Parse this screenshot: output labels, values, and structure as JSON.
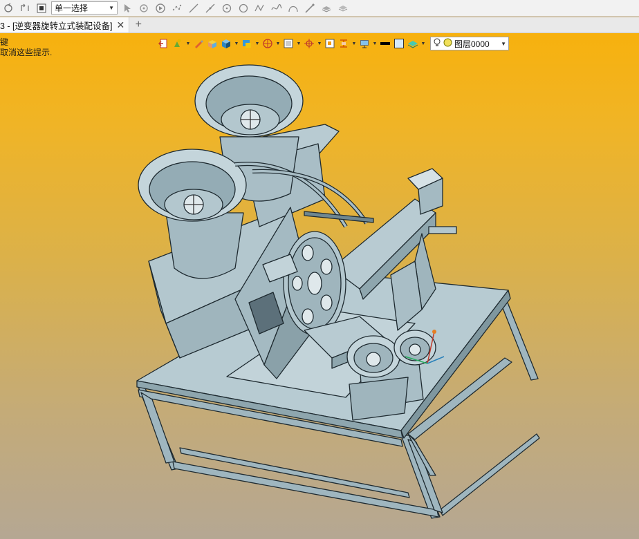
{
  "toolbar": {
    "selection_mode": "单一选择",
    "icons": [
      "rotate-icon",
      "pan-icon",
      "stop-icon",
      "select-arrow-icon",
      "filter-icon",
      "play-icon",
      "point-cloud-icon",
      "line-icon",
      "dash-line-icon",
      "circle-point-icon",
      "circle-icon",
      "polyline-icon",
      "spline-icon",
      "arc-icon",
      "brush-icon",
      "layer-stack-icon",
      "layer-tilt-icon"
    ]
  },
  "tab": {
    "title": "3 - [逆变器旋转立式装配设备]",
    "add_label": "+"
  },
  "viewport": {
    "hint_line1": "键",
    "hint_line2": "取消这些提示."
  },
  "layer": {
    "name": "图层0000"
  },
  "colors": {
    "viewport_top": "#f7b10e",
    "viewport_bottom": "#b5a793",
    "model_fill": "#a9bfc7",
    "model_edge": "#1e2a30"
  }
}
